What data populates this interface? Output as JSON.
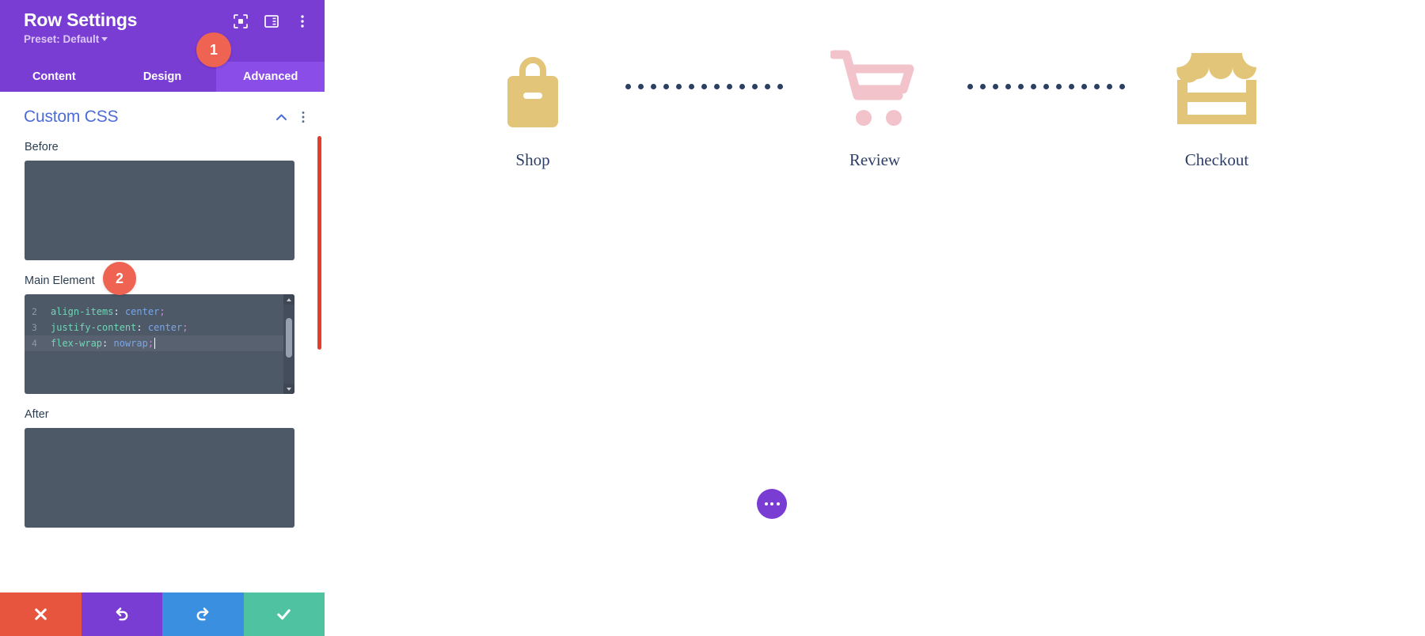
{
  "panel": {
    "title": "Row Settings",
    "preset_label": "Preset: Default",
    "header_icons": [
      {
        "name": "focus-target-icon"
      },
      {
        "name": "layout-panel-icon"
      },
      {
        "name": "more-vertical-icon"
      }
    ],
    "tabs": [
      {
        "label": "Content",
        "active": false
      },
      {
        "label": "Design",
        "active": false
      },
      {
        "label": "Advanced",
        "active": true
      }
    ],
    "section": {
      "title": "Custom CSS",
      "collapse_icon": "chevron-up-icon",
      "options_icon": "more-vertical-icon"
    },
    "fields": [
      {
        "label": "Before",
        "value": ""
      },
      {
        "label": "Main Element",
        "value": ""
      },
      {
        "label": "After",
        "value": ""
      }
    ],
    "code": {
      "lines": [
        {
          "num": "2",
          "prop": "align-items",
          "colon": ":",
          "value": "center",
          "semi": ";",
          "active": false
        },
        {
          "num": "3",
          "prop": "justify-content",
          "colon": ":",
          "value": "center",
          "semi": ";",
          "active": false
        },
        {
          "num": "4",
          "prop": "flex-wrap",
          "colon": ":",
          "value": "nowrap",
          "semi": ";",
          "active": true
        }
      ]
    },
    "actions": [
      {
        "name": "cancel-button",
        "icon": "close-icon",
        "color": "#E8553F"
      },
      {
        "name": "undo-button",
        "icon": "undo-icon",
        "color": "#7A3DD4"
      },
      {
        "name": "redo-button",
        "icon": "redo-icon",
        "color": "#3B8FE0"
      },
      {
        "name": "save-button",
        "icon": "check-icon",
        "color": "#4FC3A1"
      }
    ]
  },
  "annotations": [
    {
      "id": "1",
      "label": "1"
    },
    {
      "id": "2",
      "label": "2"
    }
  ],
  "canvas": {
    "steps": [
      {
        "label": "Shop",
        "icon": "shopping-bag-icon",
        "color": "#E3C579"
      },
      {
        "label": "Review",
        "icon": "shopping-cart-icon",
        "color": "#F3C3CC"
      },
      {
        "label": "Checkout",
        "icon": "storefront-icon",
        "color": "#E3C579"
      }
    ],
    "connector_dot_count": 13,
    "connector_color": "#2E3F66",
    "fab": {
      "name": "page-settings-button",
      "icon": "ellipsis-icon",
      "color": "#7A3DD4"
    }
  }
}
